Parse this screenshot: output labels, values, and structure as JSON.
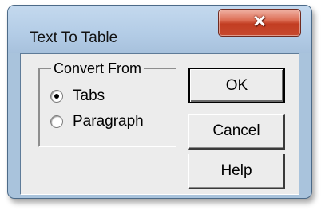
{
  "dialog": {
    "title": "Text To Table",
    "close_glyph": "✕",
    "group": {
      "label": "Convert From",
      "options": [
        {
          "label": "Tabs",
          "selected": true
        },
        {
          "label": "Paragraph",
          "selected": false
        }
      ]
    },
    "buttons": {
      "ok": "OK",
      "cancel": "Cancel",
      "help": "Help"
    }
  },
  "colors": {
    "titlebar": "#b3cce6",
    "client": "#ececec",
    "close_button": "#c23d22"
  }
}
